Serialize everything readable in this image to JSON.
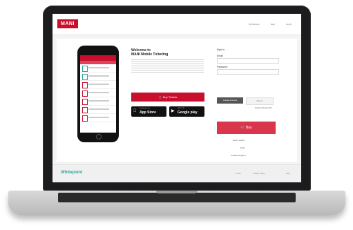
{
  "header": {
    "logo": "MANI",
    "nav": [
      "My Account",
      "Help",
      "Log In"
    ]
  },
  "welcome": {
    "title_line1": "Welcome to",
    "title_line2": "MANI Mobile Ticketing",
    "buy_button": "Buy Tickets"
  },
  "stores": {
    "appstore_small": "Download on the",
    "appstore_big": "App Store",
    "googleplay_small": "GET IT ON",
    "googleplay_big": "Google play"
  },
  "signin": {
    "heading": "Sign In",
    "email_label": "Email",
    "email_value": "",
    "password_label": "Password",
    "password_value": "",
    "primary_button": "Create Account",
    "secondary_button": "Sign In",
    "forgot_link": "Forgot Password?",
    "big_button": "Buy",
    "links": [
      "How it works",
      "FAQ",
      "Contact Support"
    ]
  },
  "footer": {
    "logo": "Whitepoint",
    "links": [
      "Terms",
      "Privacy Policy",
      "Help"
    ]
  },
  "colors": {
    "brand_red": "#c8102e",
    "accent_teal": "#2aa6a0"
  }
}
